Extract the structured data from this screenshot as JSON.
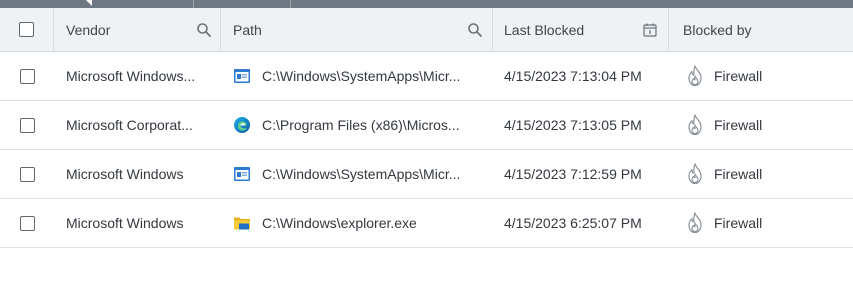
{
  "header": {
    "vendor": "Vendor",
    "path": "Path",
    "last_blocked": "Last Blocked",
    "blocked_by": "Blocked by"
  },
  "rows": [
    {
      "vendor": "Microsoft Windows...",
      "path_icon": "windows-app-icon",
      "path": "C:\\Windows\\SystemApps\\Micr...",
      "last_blocked": "4/15/2023 7:13:04 PM",
      "blocked_by": "Firewall"
    },
    {
      "vendor": "Microsoft Corporat...",
      "path_icon": "edge-browser-icon",
      "path": "C:\\Program Files (x86)\\Micros...",
      "last_blocked": "4/15/2023 7:13:05 PM",
      "blocked_by": "Firewall"
    },
    {
      "vendor": "Microsoft Windows",
      "path_icon": "windows-app-icon",
      "path": "C:\\Windows\\SystemApps\\Micr...",
      "last_blocked": "4/15/2023 7:12:59 PM",
      "blocked_by": "Firewall"
    },
    {
      "vendor": "Microsoft Windows",
      "path_icon": "folder-icon",
      "path": "C:\\Windows\\explorer.exe",
      "last_blocked": "4/15/2023 6:25:07 PM",
      "blocked_by": "Firewall"
    }
  ],
  "colors": {
    "header_bg": "#eef2f5",
    "topbar": "#6d7882",
    "edge_blue": "#1a7fd6",
    "folder_yellow": "#f2c230"
  }
}
